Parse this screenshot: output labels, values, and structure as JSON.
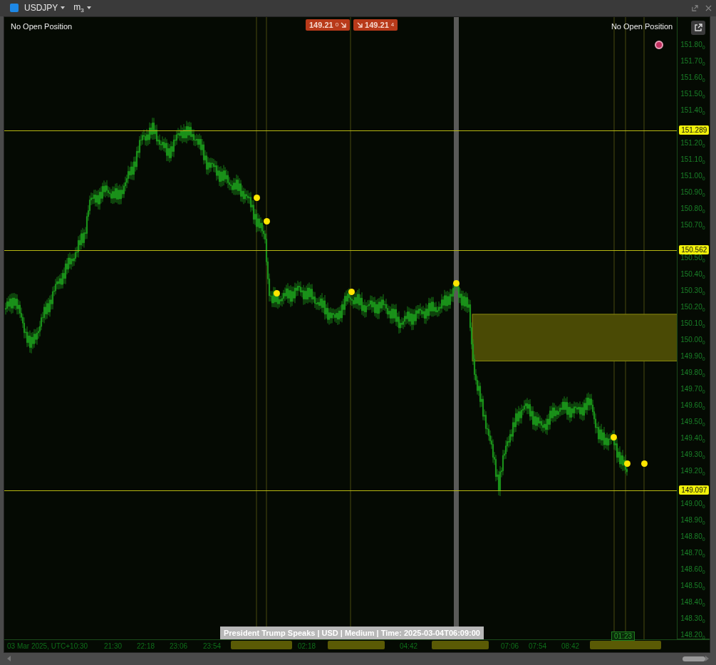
{
  "window": {
    "symbol": "USDJPY",
    "timeframe": "m",
    "timeframe_sub": "3"
  },
  "positions": [
    "No Open Position",
    "No Open Position"
  ],
  "quotes": [
    {
      "kind": "sell",
      "price": "149.21",
      "pip": "0"
    },
    {
      "kind": "buy",
      "price": "149.21",
      "pip": "4"
    }
  ],
  "price_axis": [
    "151.80$_{0}$",
    "151.70$_{0}$",
    "151.60$_{0}$",
    "151.50$_{0}$",
    "151.40$_{0}$",
    "151.20$_{0}$",
    "151.10$_{0}$",
    "151.00$_{0}$",
    "150.90$_{0}$",
    "150.80$_{0}$",
    "150.70$_{0}$",
    "150.50$_{0}$",
    "150.40$_{0}$",
    "150.30$_{0}$",
    "150.20$_{0}$",
    "150.10$_{0}$",
    "150.00$_{0}$",
    "149.90$_{0}$",
    "149.80$_{0}$",
    "149.70$_{0}$",
    "149.60$_{0}$",
    "149.50$_{0}$",
    "149.40$_{0}$",
    "149.30$_{0}$",
    "149.20$_{0}$",
    "149.00$_{0}$",
    "148.90$_{0}$",
    "148.80$_{0}$",
    "148.70$_{0}$",
    "148.60$_{0}$",
    "148.50$_{0}$",
    "148.40$_{0}$",
    "148.30$_{0}$",
    "148.20$_{0}$"
  ],
  "levels": [
    "151.289",
    "150.562",
    "149.097"
  ],
  "time_axis": [
    "03 Mar 2025, UTC+10:30",
    "21:30",
    "22:18",
    "23:06",
    "23:54",
    "02:18",
    "04:42",
    "07:06",
    "07:54",
    "08:42"
  ],
  "cursor_time": "01:23",
  "event_tooltip": "President Trump Speaks | USD | Medium | Time: 2025-03-04T06:09:00"
}
